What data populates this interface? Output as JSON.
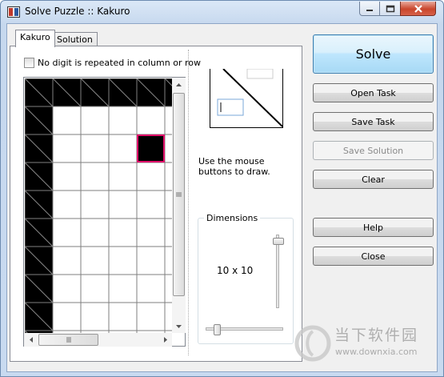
{
  "window": {
    "title": "Solve Puzzle :: Kakuro"
  },
  "tabs": [
    {
      "label": "Kakuro",
      "active": true
    },
    {
      "label": "Solution",
      "active": false
    }
  ],
  "options": {
    "no_repeat_label": "No digit is repeated in column or row",
    "no_repeat_checked": false
  },
  "grid": {
    "cells": [
      "XXXXXX",
      "X.....",
      "X...X.",
      "X.....",
      "X.....",
      "X.....",
      "X.....",
      "X.....",
      "X.....",
      "X....."
    ],
    "diagonal_cells": [
      [
        0,
        0
      ],
      [
        0,
        1
      ],
      [
        0,
        2
      ],
      [
        0,
        3
      ],
      [
        0,
        4
      ],
      [
        0,
        5
      ],
      [
        1,
        0
      ],
      [
        2,
        0
      ],
      [
        3,
        0
      ],
      [
        4,
        0
      ],
      [
        5,
        0
      ],
      [
        6,
        0
      ],
      [
        7,
        0
      ],
      [
        8,
        0
      ],
      [
        9,
        0
      ]
    ],
    "selected_cell": [
      2,
      4
    ],
    "selection_color": "#e0106a"
  },
  "drawing": {
    "hint": "Use the mouse buttons to draw."
  },
  "dimensions": {
    "group_label": "Dimensions",
    "value": "10 x 10"
  },
  "buttons": {
    "solve": "Solve",
    "open_task": "Open Task",
    "save_task": "Save Task",
    "save_solution": "Save Solution",
    "clear": "Clear",
    "help": "Help",
    "close": "Close"
  },
  "watermark": {
    "text": "当下软件园",
    "url": "www.downxia.com"
  },
  "icons": [
    "app-icon",
    "minimize-icon",
    "maximize-icon",
    "close-icon",
    "scroll-up-icon",
    "scroll-down-icon",
    "scroll-left-icon",
    "scroll-right-icon",
    "grip-icon",
    "watermark-logo-icon"
  ],
  "colors": {
    "solve_button": "#bee6fd",
    "close_button": "#c9462c",
    "selection": "#e0106a"
  }
}
